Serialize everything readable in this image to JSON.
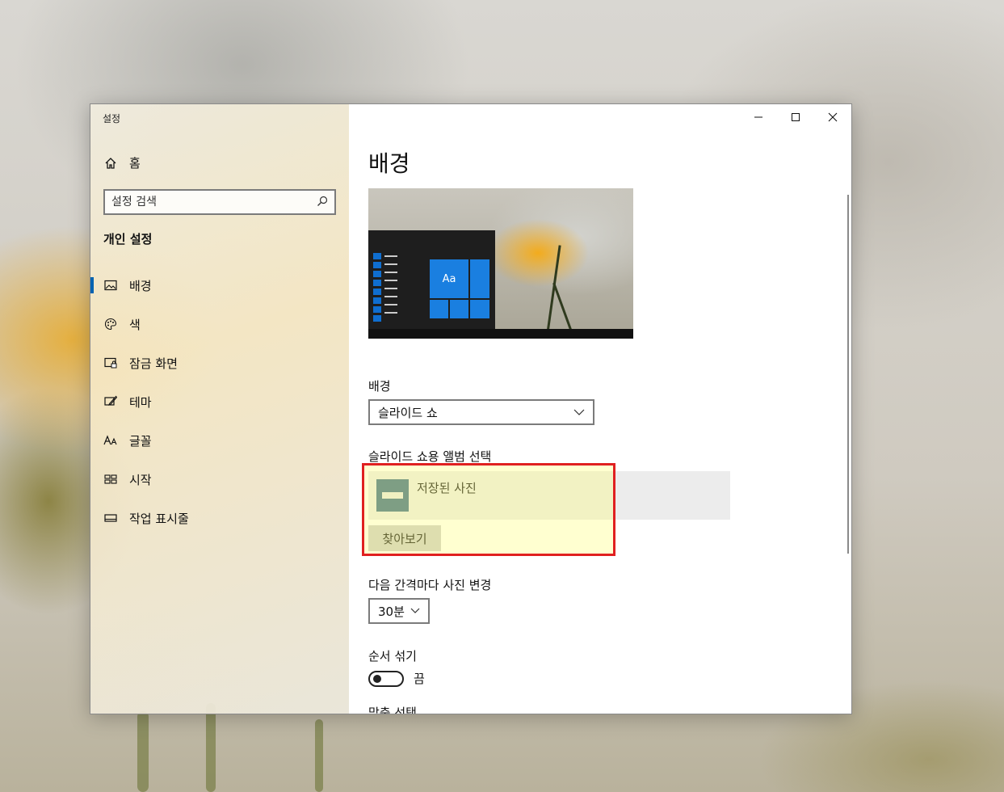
{
  "window": {
    "title": "설정",
    "controls": [
      "minimize",
      "maximize",
      "close"
    ]
  },
  "sidebar": {
    "home_label": "홈",
    "search_placeholder": "설정 검색",
    "section_title": "개인 설정",
    "items": [
      {
        "label": "배경",
        "icon": "image-icon",
        "active": true
      },
      {
        "label": "색",
        "icon": "palette-icon",
        "active": false
      },
      {
        "label": "잠금 화면",
        "icon": "lock-screen-icon",
        "active": false
      },
      {
        "label": "테마",
        "icon": "theme-brush-icon",
        "active": false
      },
      {
        "label": "글꼴",
        "icon": "font-icon",
        "active": false
      },
      {
        "label": "시작",
        "icon": "start-tiles-icon",
        "active": false
      },
      {
        "label": "작업 표시줄",
        "icon": "taskbar-icon",
        "active": false
      }
    ]
  },
  "main": {
    "title": "배경",
    "preview_tile_text": "Aa",
    "background_label": "배경",
    "background_value": "슬라이드 쇼",
    "album_label": "슬라이드 쇼용 앨범 선택",
    "album_name": "저장된 사진",
    "browse_label": "찾아보기",
    "interval_label": "다음 간격마다 사진 변경",
    "interval_value": "30분",
    "shuffle_label": "순서 섞기",
    "shuffle_state": "끔",
    "fit_label": "맞춤 선택"
  },
  "colors": {
    "accent": "#0063b1",
    "highlight_border": "#e02020",
    "highlight_fill": "#ffff78"
  }
}
